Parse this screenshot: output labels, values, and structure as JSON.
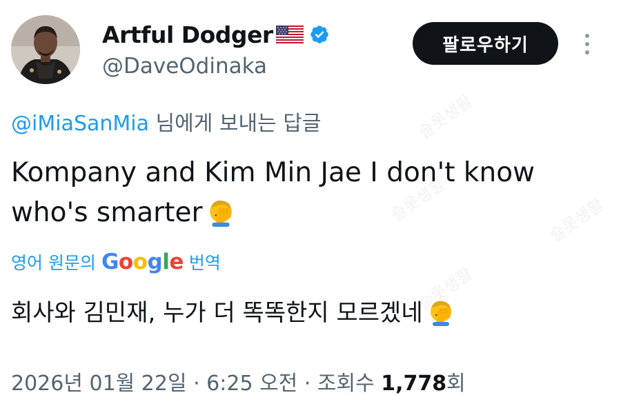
{
  "author": {
    "display_name": "Artful Dodger",
    "handle": "@DaveOdinaka",
    "flag_icon": "us-flag-icon",
    "verified_icon": "verified-badge-icon",
    "verified_color": "#1d9bf0"
  },
  "follow_button": {
    "label": "팔로우하기"
  },
  "more_menu": {
    "icon": "more-vertical-icon"
  },
  "reply_context": {
    "handle": "@iMiaSanMia",
    "suffix": " 님에게 보내는 답글"
  },
  "tweet": {
    "text": "Kompany and Kim Min Jae I don't know who's smarter",
    "emoji_icon": "face-palm-emoji"
  },
  "translation": {
    "prefix": "영어 원문의",
    "provider": "Google",
    "suffix": "번역",
    "text": "회사와 김민재, 누가 더 똑똑한지 모르겠네"
  },
  "meta": {
    "timestamp": "2026년 01월 22일 · 6:25 오전 · 조회수 ",
    "views": "1,778",
    "views_suffix": "회"
  },
  "colors": {
    "link": "#1d9bf0",
    "secondary_text": "#536471",
    "primary_text": "#0f1419",
    "button_bg": "#0f1419"
  }
}
